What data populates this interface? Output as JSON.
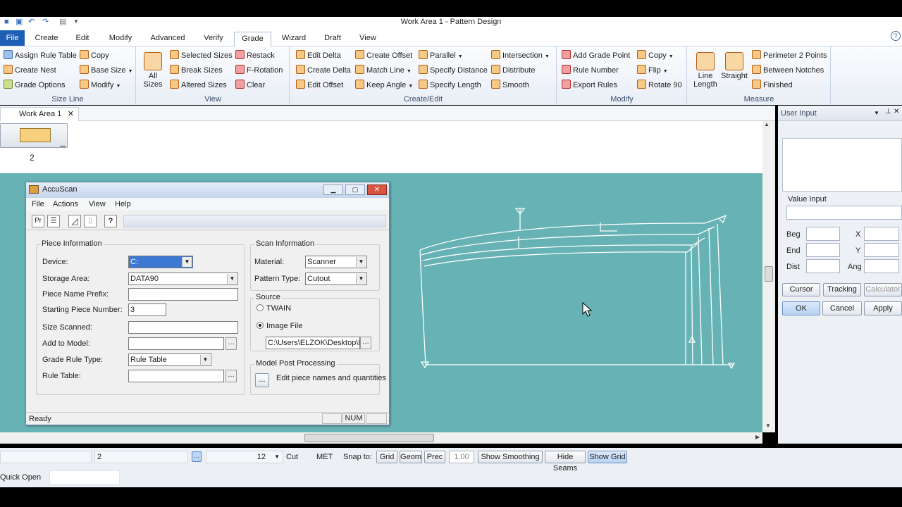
{
  "window_title": "Work Area 1 - Pattern Design",
  "menu": {
    "file": "File",
    "create": "Create",
    "edit": "Edit",
    "modify": "Modify",
    "advanced": "Advanced",
    "verify": "Verify",
    "grade": "Grade",
    "wizard": "Wizard",
    "draft": "Draft",
    "view": "View"
  },
  "ribbon": {
    "size_line": {
      "label": "Size Line",
      "assign_rule_table": "Assign Rule Table",
      "copy": "Copy",
      "create_nest": "Create Nest",
      "base_size": "Base Size",
      "grade_options": "Grade Options",
      "modify": "Modify"
    },
    "view": {
      "label": "View",
      "all_sizes_1": "All",
      "all_sizes_2": "Sizes",
      "selected_sizes": "Selected Sizes",
      "restack": "Restack",
      "break_sizes": "Break Sizes",
      "f_rotation": "F-Rotation",
      "altered_sizes": "Altered Sizes",
      "clear": "Clear"
    },
    "create_edit": {
      "label": "Create/Edit",
      "edit_delta": "Edit Delta",
      "create_offset": "Create Offset",
      "parallel": "Parallel",
      "intersection": "Intersection",
      "create_delta": "Create Delta",
      "match_line": "Match Line",
      "specify_distance": "Specify Distance",
      "distribute": "Distribute",
      "edit_offset": "Edit Offset",
      "keep_angle": "Keep Angle",
      "specify_length": "Specify Length",
      "smooth": "Smooth"
    },
    "modify": {
      "label": "Modify",
      "add_grade_point": "Add Grade Point",
      "copy": "Copy",
      "rule_number": "Rule Number",
      "flip": "Flip",
      "export_rules": "Export Rules",
      "rotate_90": "Rotate 90"
    },
    "measure": {
      "label": "Measure",
      "line_length_1": "Line",
      "line_length_2": "Length",
      "straight": "Straight",
      "perimeter_2_points": "Perimeter 2 Points",
      "between_notches": "Between Notches",
      "finished": "Finished"
    }
  },
  "doc_tab": "Work Area 1",
  "piece_count": "2",
  "dialog": {
    "title": "AccuScan",
    "menu": {
      "file": "File",
      "actions": "Actions",
      "view": "View",
      "help": "Help"
    },
    "piece_info": {
      "legend": "Piece Information",
      "device_label": "Device:",
      "device_value": "C:",
      "storage_label": "Storage Area:",
      "storage_value": "DATA90",
      "prefix_label": "Piece Name Prefix:",
      "start_label": "Starting Piece Number:",
      "start_value": "3",
      "size_label": "Size Scanned:",
      "model_label": "Add to Model:",
      "grade_label": "Grade Rule Type:",
      "grade_value": "Rule Table",
      "rule_label": "Rule Table:"
    },
    "scan_info": {
      "legend": "Scan Information",
      "material_label": "Material:",
      "material_value": "Scanner",
      "pattern_label": "Pattern Type:",
      "pattern_value": "Cutout"
    },
    "source": {
      "legend": "Source",
      "twain": "TWAIN",
      "image_file": "Image File",
      "path": "C:\\Users\\ELZOK\\Desktop\\IM"
    },
    "post": {
      "legend": "Model Post Processing",
      "text": "Edit piece names and quantities",
      "btn": "..."
    },
    "status": "Ready",
    "num": "NUM"
  },
  "user_input": {
    "title": "User Input",
    "value_input": "Value Input",
    "beg": "Beg",
    "end": "End",
    "dist": "Dist",
    "x": "X",
    "y": "Y",
    "ang": "Ang",
    "cursor": "Cursor",
    "tracking": "Tracking",
    "calculator": "Calculator",
    "ok": "OK",
    "cancel": "Cancel",
    "apply": "Apply"
  },
  "statusbar": {
    "field2": "2",
    "size": "12",
    "cut": "Cut",
    "met": "MET",
    "snap_to": "Snap to:",
    "grid": "Grid",
    "geom": "Geom",
    "prec": "Prec",
    "precision": "1.00",
    "show_smoothing": "Show Smoothing",
    "hide_seams": "Hide Seams",
    "show_grid": "Show Grid",
    "quick_open": "Quick Open"
  },
  "colors": {
    "workarea": "#66b2b4",
    "file_tab": "#1f5fb6"
  }
}
